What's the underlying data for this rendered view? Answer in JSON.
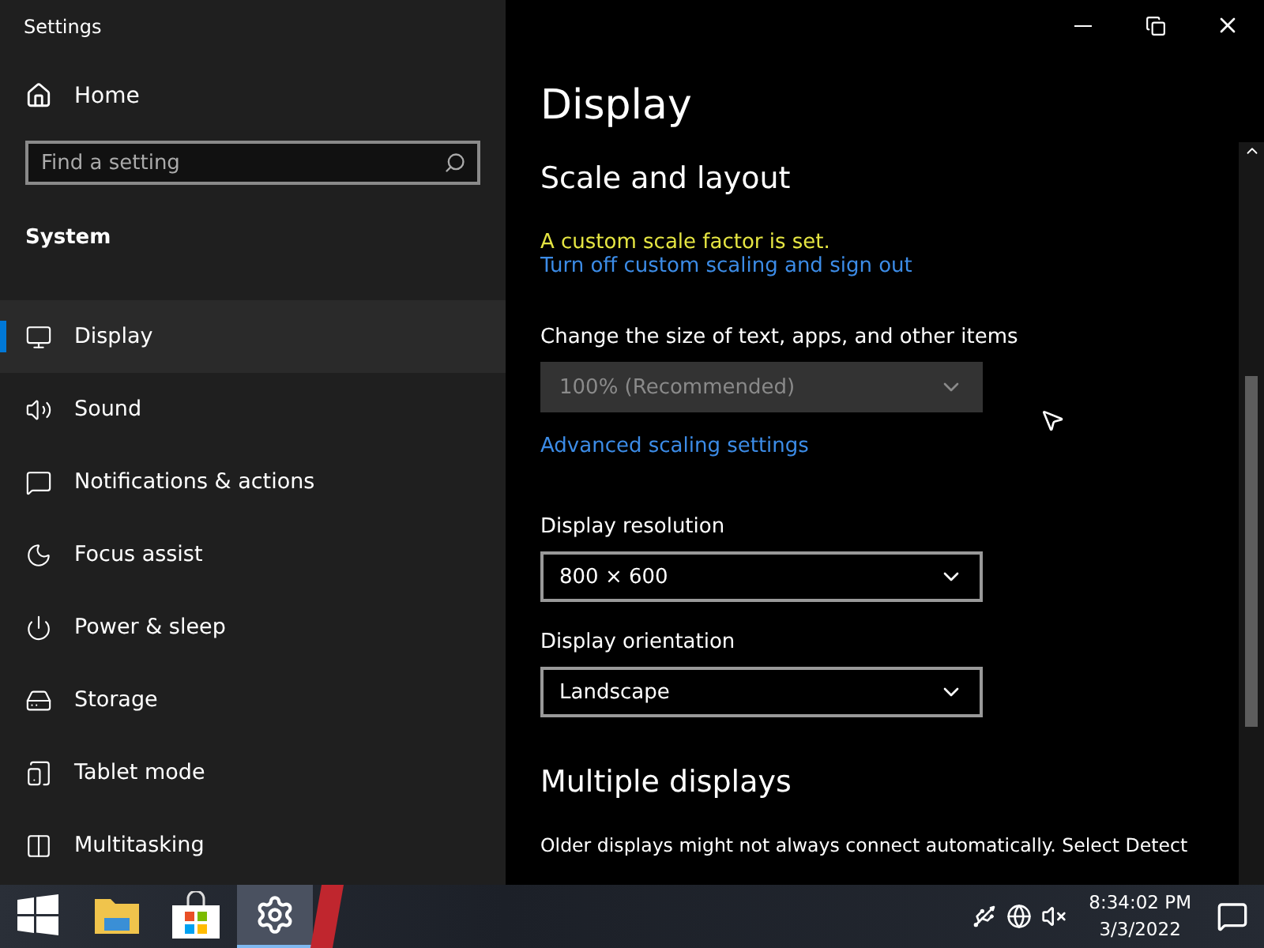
{
  "window": {
    "title": "Settings"
  },
  "sidebar": {
    "home": "Home",
    "search": {
      "placeholder": "Find a setting"
    },
    "section": "System",
    "items": [
      {
        "label": "Display",
        "selected": true
      },
      {
        "label": "Sound",
        "selected": false
      },
      {
        "label": "Notifications & actions",
        "selected": false
      },
      {
        "label": "Focus assist",
        "selected": false
      },
      {
        "label": "Power & sleep",
        "selected": false
      },
      {
        "label": "Storage",
        "selected": false
      },
      {
        "label": "Tablet mode",
        "selected": false
      },
      {
        "label": "Multitasking",
        "selected": false
      }
    ]
  },
  "page": {
    "title": "Display",
    "sections": [
      {
        "heading": "Scale and layout",
        "warning": "A custom scale factor is set.",
        "warning_link": "Turn off custom scaling and sign out",
        "fields": [
          {
            "label": "Change the size of text, apps, and other items",
            "value": "100% (Recommended)",
            "disabled": true,
            "link": "Advanced scaling settings"
          },
          {
            "label": "Display resolution",
            "value": "800 × 600",
            "disabled": false
          },
          {
            "label": "Display orientation",
            "value": "Landscape",
            "disabled": false
          }
        ]
      },
      {
        "heading": "Multiple displays",
        "text": "Older displays might not always connect automatically. Select Detect"
      }
    ]
  },
  "taskbar": {
    "apps": [
      {
        "selected": false
      },
      {
        "selected": false
      },
      {
        "selected": false
      },
      {
        "selected": true
      }
    ],
    "time": "8:34:02 PM",
    "date": "3/3/2022"
  }
}
